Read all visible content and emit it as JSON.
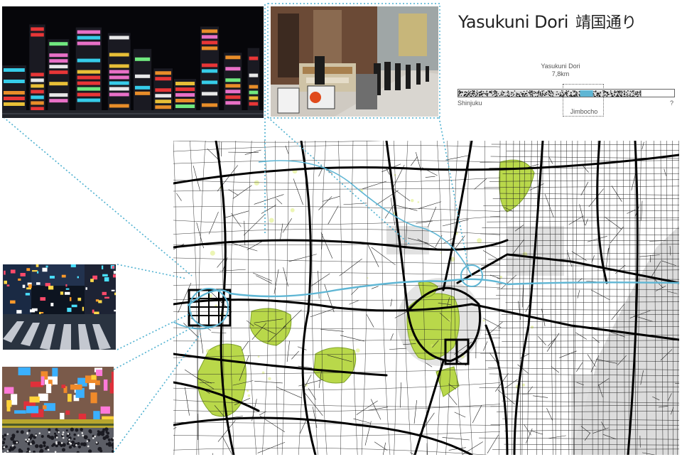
{
  "title": {
    "main": "Yasukuni Dori",
    "japanese": "靖国通り"
  },
  "route": {
    "name": "Yasukuni Dori",
    "length": "7,8km",
    "start": "Shinjuku",
    "end": "?",
    "focus": "Jimbocho",
    "focus_fraction": [
      0.56,
      0.62
    ]
  },
  "photos": [
    {
      "id": "night-skyline",
      "subject": "neon-signs-skyline"
    },
    {
      "id": "bookstalls",
      "subject": "jimbocho-book-stalls"
    },
    {
      "id": "crossing",
      "subject": "night-crosswalk"
    },
    {
      "id": "crowd",
      "subject": "crowd-under-overpass"
    }
  ],
  "colors": {
    "route": "#5fb6d4",
    "park": "#b9d84a",
    "park_dark": "#7fa32a",
    "road": "#111111",
    "callout": "#4fb1d0"
  }
}
